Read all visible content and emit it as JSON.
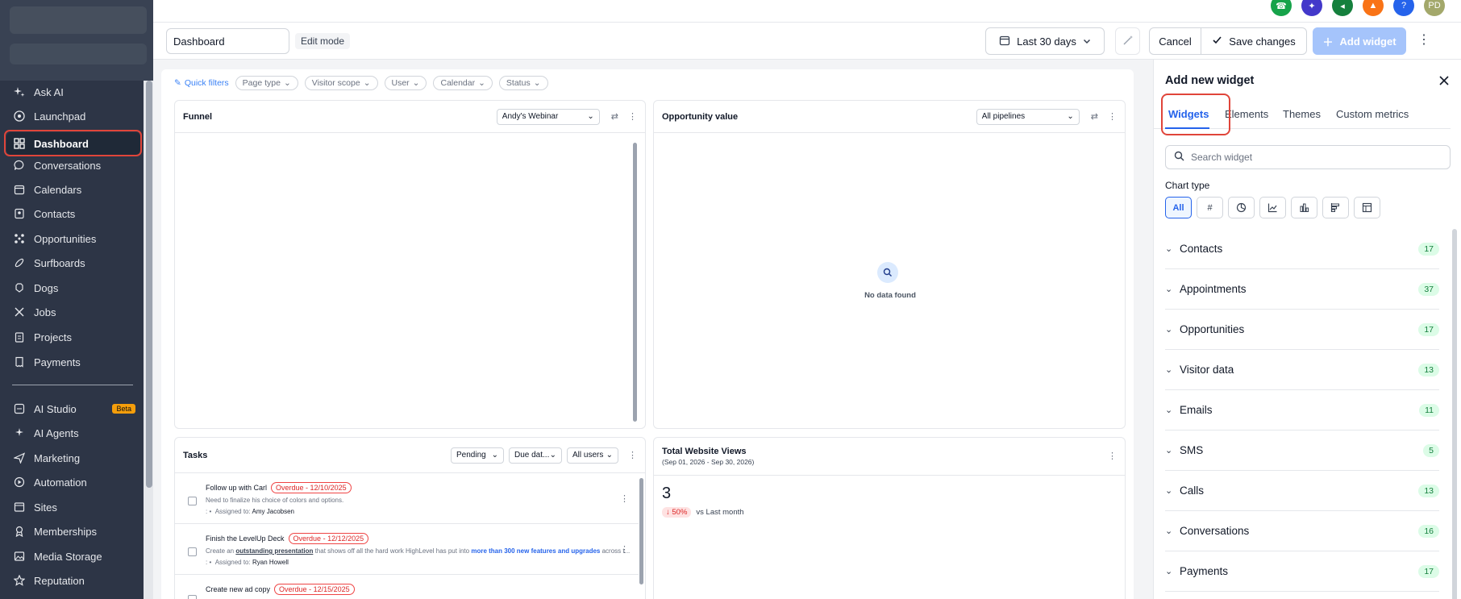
{
  "sidebar": {
    "items": [
      {
        "label": "Ask AI",
        "icon": "sparkles-icon"
      },
      {
        "label": "Launchpad",
        "icon": "rocket-icon"
      },
      {
        "label": "Dashboard",
        "icon": "grid-icon"
      },
      {
        "label": "Conversations",
        "icon": "chat-icon"
      },
      {
        "label": "Calendars",
        "icon": "calendar-icon"
      },
      {
        "label": "Contacts",
        "icon": "contacts-icon"
      },
      {
        "label": "Opportunities",
        "icon": "network-icon"
      },
      {
        "label": "Surfboards",
        "icon": "surfboard-icon"
      },
      {
        "label": "Dogs",
        "icon": "dog-icon"
      },
      {
        "label": "Jobs",
        "icon": "tools-icon"
      },
      {
        "label": "Projects",
        "icon": "clipboard-icon"
      },
      {
        "label": "Payments",
        "icon": "receipt-icon"
      }
    ],
    "items2": [
      {
        "label": "AI Studio",
        "icon": "ai-studio-icon",
        "badge": "Beta"
      },
      {
        "label": "AI Agents",
        "icon": "ai-agents-icon"
      },
      {
        "label": "Marketing",
        "icon": "send-icon"
      },
      {
        "label": "Automation",
        "icon": "automation-icon"
      },
      {
        "label": "Sites",
        "icon": "sites-icon"
      },
      {
        "label": "Memberships",
        "icon": "membership-icon"
      },
      {
        "label": "Media Storage",
        "icon": "image-icon"
      },
      {
        "label": "Reputation",
        "icon": "star-icon"
      }
    ]
  },
  "topbar": {
    "avatar": "PD",
    "icon_colors": [
      "#16a34a",
      "#4338ca",
      "#15803d",
      "#f97316",
      "#2563eb",
      "#9ca36b"
    ]
  },
  "toolbar": {
    "dashboard_name": "Dashboard",
    "edit_mode": "Edit mode",
    "date_range": "Last 30 days",
    "cancel": "Cancel",
    "save": "Save changes",
    "add_widget": "Add widget"
  },
  "quick_filters": {
    "label": "Quick filters",
    "chips": [
      "Page type",
      "Visitor scope",
      "User",
      "Calendar",
      "Status"
    ]
  },
  "funnel": {
    "title": "Funnel",
    "select": "Andy's Webinar"
  },
  "opportunity": {
    "title": "Opportunity value",
    "select": "All pipelines",
    "empty": "No data found"
  },
  "tasks": {
    "title": "Tasks",
    "filters": [
      "Pending",
      "Due dat...",
      "All users"
    ],
    "rows": [
      {
        "title": "Follow up with Carl",
        "overdue": "Overdue - 12/10/2025",
        "desc": "Need to finalize his choice of colors and options.",
        "assigned_label": "Assigned to:",
        "assignee": "Amy Jacobsen"
      },
      {
        "title": "Finish the LevelUp Deck",
        "overdue": "Overdue - 12/12/2025",
        "desc_pre": "Create an ",
        "desc_link1": "outstanding presentation",
        "desc_mid": " that shows off all the hard work HighLevel has put into ",
        "desc_link2": "more than 300 new features and upgrades",
        "desc_post": " across t...",
        "assigned_label": "Assigned to:",
        "assignee": "Ryan Howell"
      },
      {
        "title": "Create new ad copy",
        "overdue": "Overdue - 12/15/2025"
      }
    ]
  },
  "website_views": {
    "title": "Total Website Views",
    "range": "(Sep 01, 2026 - Sep 30, 2026)",
    "value": "3",
    "change": "50%",
    "compare": "vs Last month"
  },
  "panel": {
    "title": "Add new widget",
    "tabs": [
      "Widgets",
      "Elements",
      "Themes",
      "Custom metrics"
    ],
    "search_placeholder": "Search widget",
    "chart_type_label": "Chart type",
    "chart_types": [
      "All",
      "#"
    ],
    "categories": [
      {
        "name": "Contacts",
        "count": "17"
      },
      {
        "name": "Appointments",
        "count": "37"
      },
      {
        "name": "Opportunities",
        "count": "17"
      },
      {
        "name": "Visitor data",
        "count": "13"
      },
      {
        "name": "Emails",
        "count": "11"
      },
      {
        "name": "SMS",
        "count": "5"
      },
      {
        "name": "Calls",
        "count": "13"
      },
      {
        "name": "Conversations",
        "count": "16"
      },
      {
        "name": "Payments",
        "count": "17"
      }
    ]
  }
}
